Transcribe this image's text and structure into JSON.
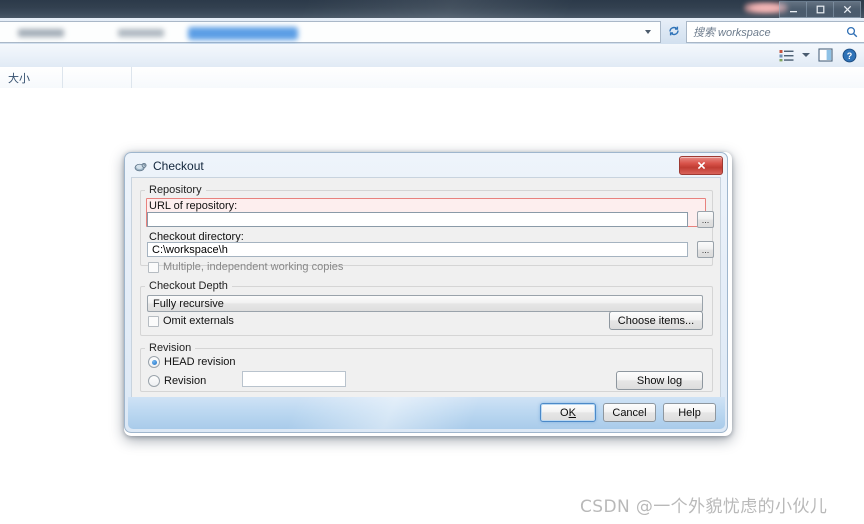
{
  "explorer": {
    "window_controls": {
      "minimize": "–",
      "maximize": "❐",
      "close": "✕"
    },
    "address_bar": {
      "value": "",
      "dropdown_icon": "chevron-down-icon",
      "refresh_icon": "refresh-icon"
    },
    "search": {
      "placeholder": "搜索 workspace",
      "icon": "search-icon"
    },
    "toolbar": {
      "view_icon": "view-options-icon",
      "view_caret": "chevron-down-icon",
      "preview_icon": "preview-pane-icon",
      "help_icon": "help-icon"
    },
    "columns": [
      {
        "label": "大小"
      },
      {
        "label": ""
      }
    ]
  },
  "dialog": {
    "title": "Checkout",
    "title_icon": "tortoisesvn-icon",
    "close_label": "✕",
    "repository": {
      "group_label": "Repository",
      "url_label": "URL of repository:",
      "url_value": "",
      "url_browse_label": "...",
      "directory_label": "Checkout directory:",
      "directory_value": "C:\\workspace\\h",
      "directory_browse_label": "...",
      "multiple_copies_label": "Multiple, independent working copies",
      "multiple_copies_checked": false
    },
    "depth": {
      "group_label": "Checkout Depth",
      "selected": "Fully recursive",
      "options": [
        "Fully recursive"
      ],
      "omit_externals_label": "Omit externals",
      "omit_externals_checked": false,
      "choose_items_label": "Choose items..."
    },
    "revision": {
      "group_label": "Revision",
      "head_label": "HEAD revision",
      "head_selected": true,
      "revision_label": "Revision",
      "revision_selected": false,
      "revision_value": "",
      "show_log_label": "Show log"
    },
    "footer": {
      "ok_label": "OK",
      "ok_mnemonic": "K",
      "cancel_label": "Cancel",
      "help_label": "Help"
    }
  },
  "watermark": {
    "text": "CSDN @一个外貌忧虑的小伙儿"
  }
}
